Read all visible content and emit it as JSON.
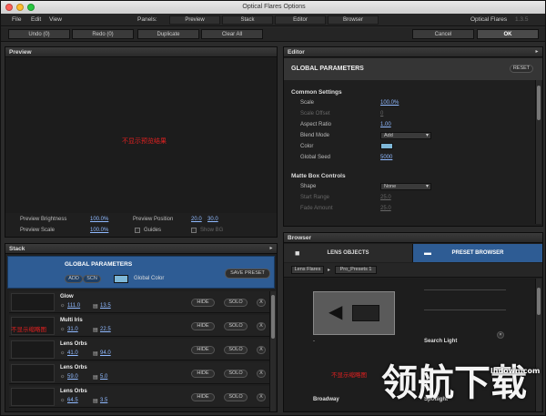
{
  "window": {
    "title": "Optical Flares Options"
  },
  "menu": {
    "file": "File",
    "edit": "Edit",
    "view": "View",
    "panels_label": "Panels:"
  },
  "panel_buttons": [
    "Preview",
    "Stack",
    "Editor",
    "Browser"
  ],
  "brand": {
    "name": "Optical Flares",
    "version": "1.3.5"
  },
  "toolbar": {
    "undo": "Undo (0)",
    "redo": "Redo (0)",
    "duplicate": "Duplicate",
    "clear_all": "Clear All",
    "cancel": "Cancel",
    "ok": "OK"
  },
  "preview": {
    "header": "Preview",
    "placeholder": "不显示预览结果",
    "brightness_label": "Preview Brightness",
    "brightness_value": "100.0%",
    "position_label": "Preview Position",
    "position_x": "20.0",
    "position_y": "30.0",
    "scale_label": "Preview Scale",
    "scale_value": "100.0%",
    "guides_label": "Guides",
    "show_bg_label": "Show BG"
  },
  "editor": {
    "header": "Editor",
    "title": "GLOBAL PARAMETERS",
    "reset": "RESET",
    "common_header": "Common Settings",
    "fields": [
      {
        "label": "Scale",
        "value": "100.0%"
      },
      {
        "label": "Scale Offset",
        "value": "0"
      },
      {
        "label": "Aspect Ratio",
        "value": "1.00"
      },
      {
        "label": "Blend Mode",
        "value": "Add"
      },
      {
        "label": "Color",
        "value": ""
      },
      {
        "label": "Global Seed",
        "value": "5000"
      }
    ],
    "matte_header": "Matte Box Controls",
    "matte_fields": [
      {
        "label": "Shape",
        "value": "None"
      },
      {
        "label": "Start Range",
        "value": "25.0"
      },
      {
        "label": "Fade Amount",
        "value": "25.0"
      }
    ],
    "color_swatch": "#7fb8d8"
  },
  "stack": {
    "header": "Stack",
    "global": {
      "title": "GLOBAL PARAMETERS",
      "add": "ADD",
      "scn": "SCN",
      "global_color": "Global Color",
      "save_preset": "SAVE PRESET"
    },
    "thumb_placeholder": "不显示缩略图",
    "hide": "HIDE",
    "solo": "SOLO",
    "close": "X",
    "items": [
      {
        "name": "Glow",
        "brightness": "111.0",
        "scale": "13.5"
      },
      {
        "name": "Multi Iris",
        "brightness": "31.0",
        "scale": "22.5"
      },
      {
        "name": "Lens Orbs",
        "brightness": "41.0",
        "scale": "94.0"
      },
      {
        "name": "Lens Orbs",
        "brightness": "59.0",
        "scale": "5.0"
      },
      {
        "name": "Lens Orbs",
        "brightness": "64.5",
        "scale": "3.5"
      }
    ]
  },
  "browser": {
    "header": "Browser",
    "tab_lens": "LENS OBJECTS",
    "tab_preset": "PRESET BROWSER",
    "crumb1": "Lens Flares",
    "crumb2": "Pro_Presets 1",
    "thumb_placeholder": "不显示缩略图",
    "items": [
      "Search Light",
      "Broadway",
      "Spotlight"
    ],
    "dash": "-"
  },
  "watermark": {
    "cn": "领航下载",
    "site": "lhdown.com"
  },
  "colors": {
    "accent": "#2e5c94",
    "link": "#8fb9ff",
    "red": "#e02020"
  }
}
